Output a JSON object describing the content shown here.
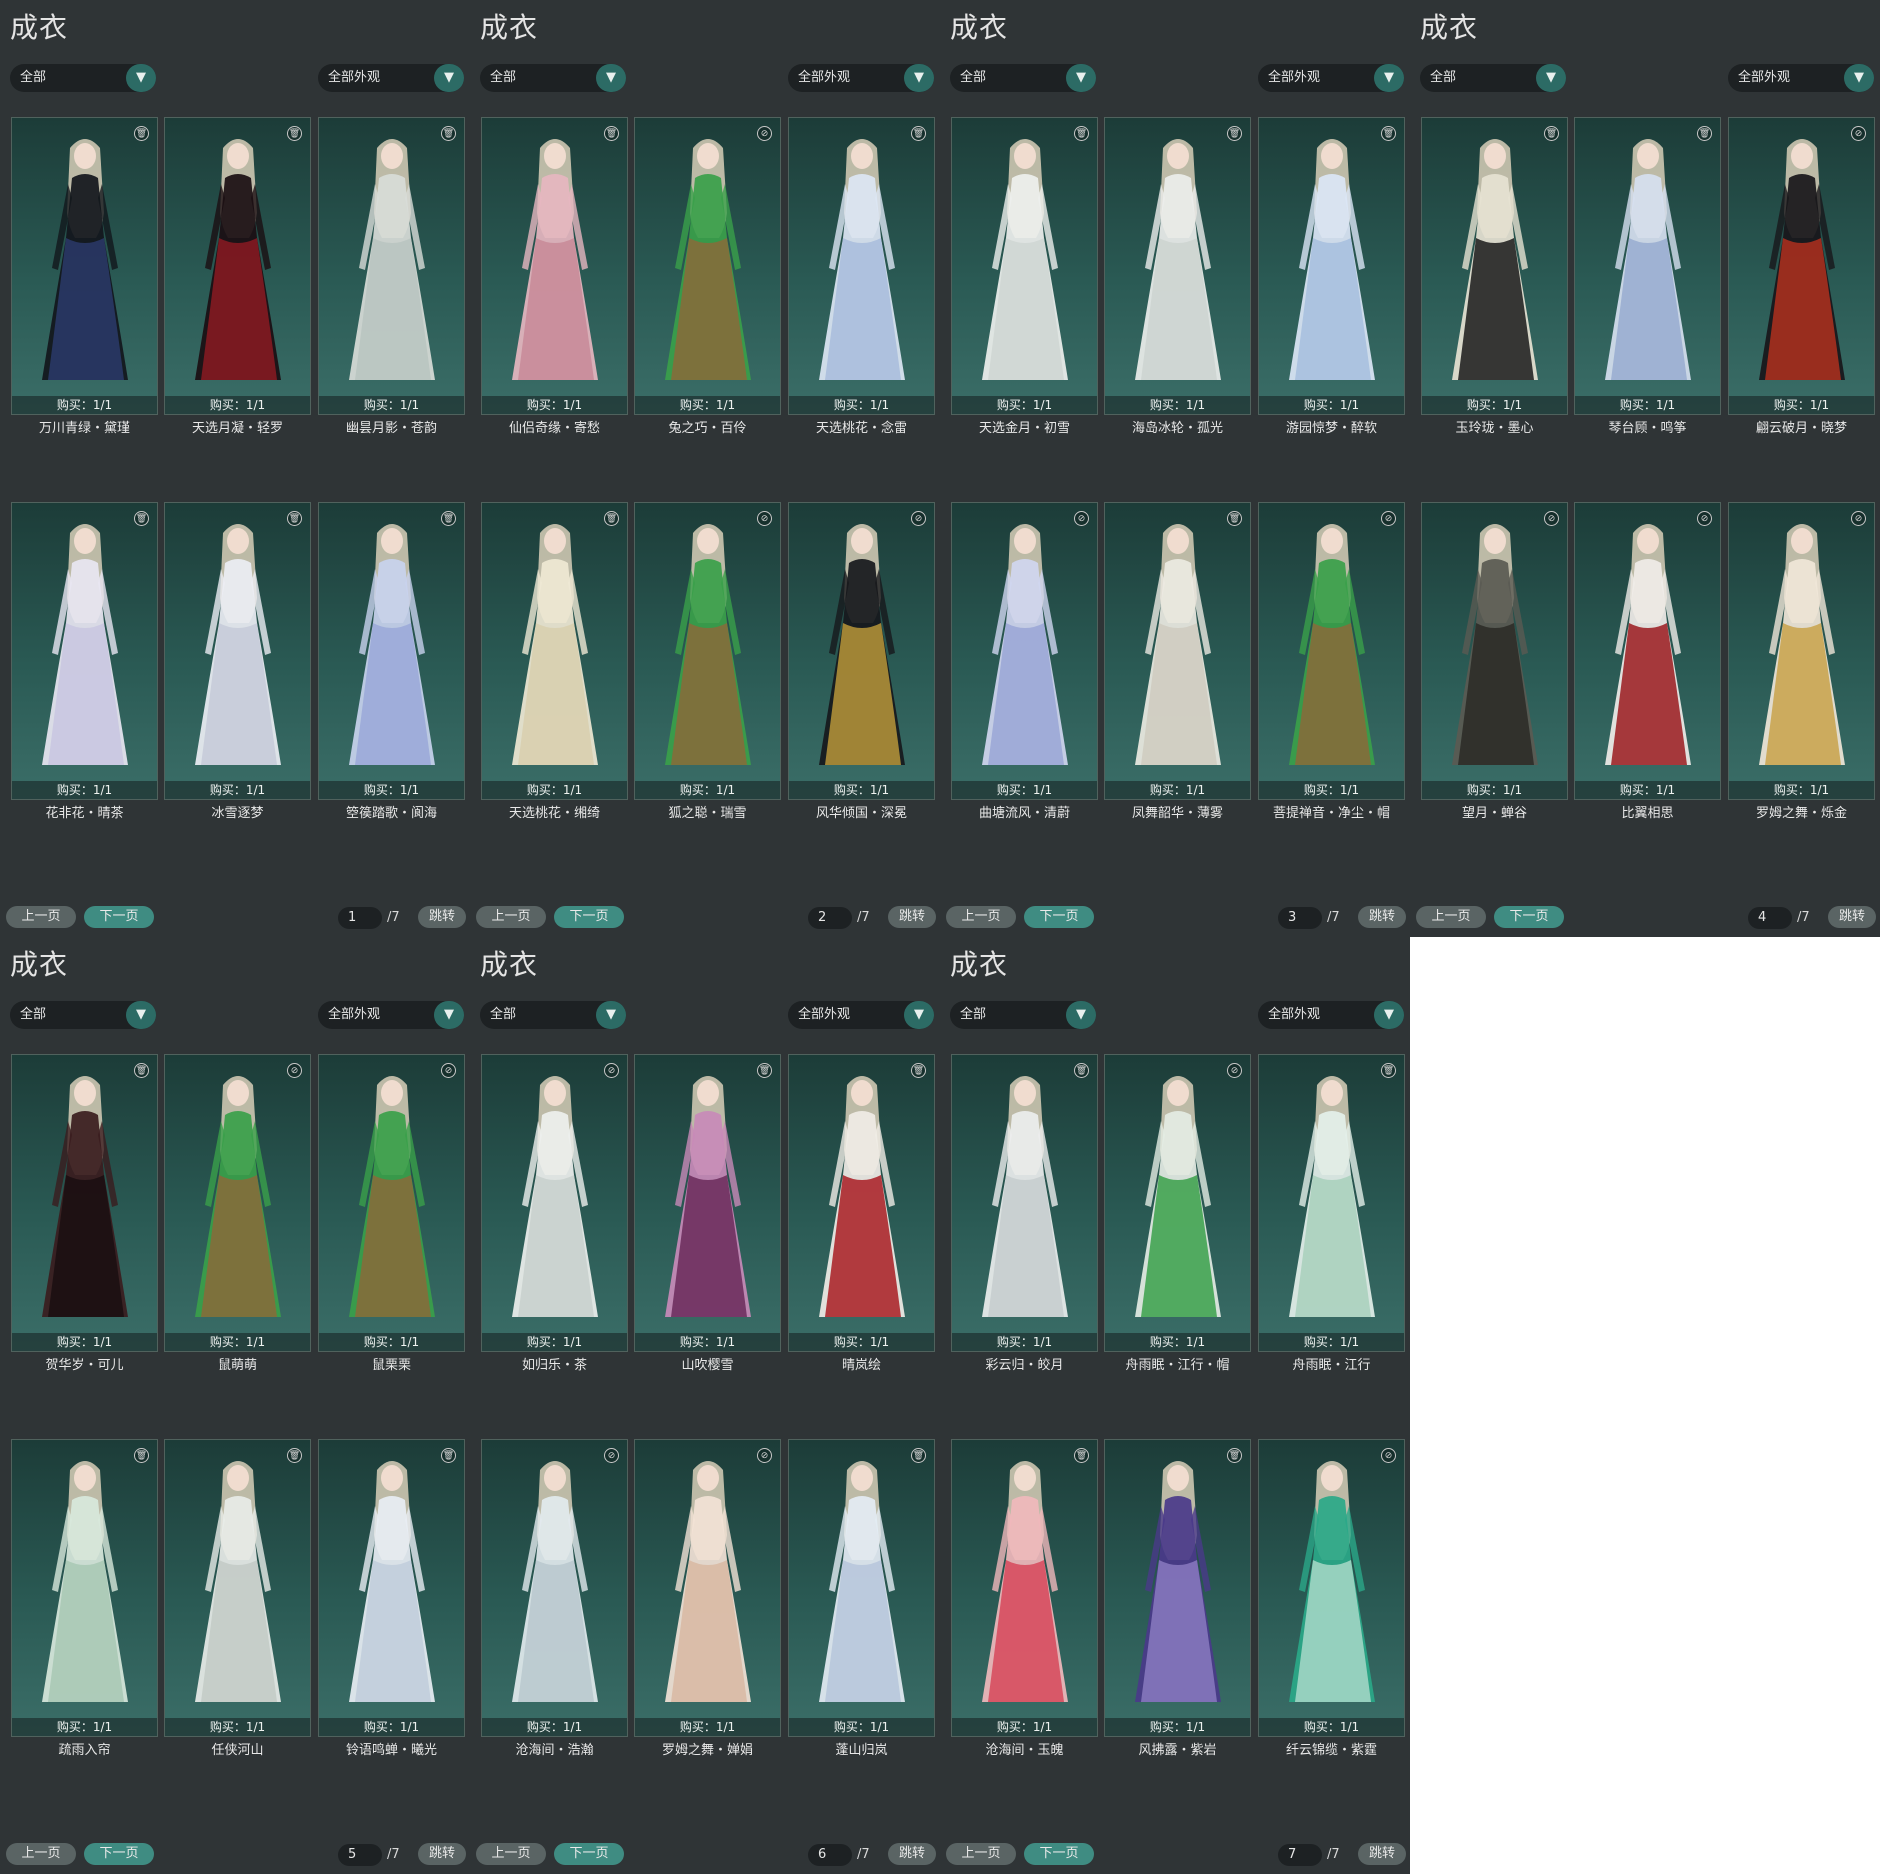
{
  "common": {
    "title": "成衣",
    "category": "全部",
    "appearance": "全部外观",
    "prev": "上一页",
    "next": "下一页",
    "jump": "跳转",
    "total": "/7",
    "purchase": "购买：1/1"
  },
  "panels": [
    {
      "page": "1",
      "items": [
        {
          "name": "万川青绿・黛瑾",
          "palette": [
            "#12161c",
            "#2a3a6a"
          ],
          "icon": "trash-icon"
        },
        {
          "name": "天选月凝・轻罗",
          "palette": [
            "#1a0e12",
            "#8a1a22"
          ],
          "icon": "trash-icon"
        },
        {
          "name": "幽昙月影・苍韵",
          "palette": [
            "#d8dcd8",
            "#b8c4c0"
          ],
          "icon": "trash-icon"
        },
        {
          "name": "花非花・晴茶",
          "palette": [
            "#e8e6f2",
            "#c8c6e0"
          ],
          "icon": "trash-icon"
        },
        {
          "name": "冰雪逐梦",
          "palette": [
            "#eceef4",
            "#c6cad8"
          ],
          "icon": "trash-icon"
        },
        {
          "name": "箜篌踏歌・阆海",
          "palette": [
            "#c8d2ee",
            "#9aa8d8"
          ],
          "icon": "trash-icon"
        }
      ]
    },
    {
      "page": "2",
      "items": [
        {
          "name": "仙侣奇缘・寄愁",
          "palette": [
            "#e6b6c0",
            "#c88a98"
          ],
          "icon": "trash-icon"
        },
        {
          "name": "兔之巧・百伶",
          "palette": [
            "#3aa04a",
            "#8a6a3a"
          ],
          "icon": "wardrobe-icon"
        },
        {
          "name": "天选桃花・念雷",
          "palette": [
            "#dce6f4",
            "#a8bcdc"
          ],
          "icon": "trash-icon"
        },
        {
          "name": "天选桃花・缃绮",
          "palette": [
            "#efe8d4",
            "#d8cfae"
          ],
          "icon": "trash-icon"
        },
        {
          "name": "狐之聪・瑞雪",
          "palette": [
            "#3aa04a",
            "#8a6a3a"
          ],
          "icon": "wardrobe-icon"
        },
        {
          "name": "风华倾国・深冕",
          "palette": [
            "#16181c",
            "#b8963a"
          ],
          "icon": "wardrobe-icon"
        }
      ]
    },
    {
      "page": "3",
      "items": [
        {
          "name": "天选金月・初雪",
          "palette": [
            "#eef0ee",
            "#cfd6d2"
          ],
          "icon": "trash-icon"
        },
        {
          "name": "海岛冰轮・孤光",
          "palette": [
            "#eceeec",
            "#cdd3d0"
          ],
          "icon": "trash-icon"
        },
        {
          "name": "游园惊梦・醉软",
          "palette": [
            "#dbe6f6",
            "#a6bede"
          ],
          "icon": "trash-icon"
        },
        {
          "name": "曲塘流风・清蔚",
          "palette": [
            "#d0d6f0",
            "#9aa6d6"
          ],
          "icon": "wardrobe-icon"
        },
        {
          "name": "凤舞韶华・薄雾",
          "palette": [
            "#eceae2",
            "#cfcbc0"
          ],
          "icon": "trash-icon"
        },
        {
          "name": "菩提禅音・净尘・帽",
          "palette": [
            "#3aa04a",
            "#8a6a3a"
          ],
          "icon": "wardrobe-icon"
        }
      ]
    },
    {
      "page": "4",
      "items": [
        {
          "name": "玉玲珑・墨心",
          "palette": [
            "#e6e2d2",
            "#1a1a1a"
          ],
          "icon": "trash-icon"
        },
        {
          "name": "琴台顾・鸣筝",
          "palette": [
            "#d6e0f0",
            "#98acd0"
          ],
          "icon": "trash-icon"
        },
        {
          "name": "翩云破月・晓梦",
          "palette": [
            "#18161a",
            "#b0301e"
          ],
          "icon": "wardrobe-icon"
        },
        {
          "name": "望月・蝉谷",
          "palette": [
            "#5a5a52",
            "#2a2a26"
          ],
          "icon": "wardrobe-icon"
        },
        {
          "name": "比翼相思",
          "palette": [
            "#f0ece8",
            "#9a1a1e"
          ],
          "icon": "wardrobe-icon"
        },
        {
          "name": "罗姆之舞・烁金",
          "palette": [
            "#f0e6d8",
            "#c8a24a"
          ],
          "icon": "wardrobe-icon"
        }
      ]
    },
    {
      "page": "5",
      "items": [
        {
          "name": "贺华岁・可儿",
          "palette": [
            "#3a1c1e",
            "#1a0e10"
          ],
          "icon": "trash-icon"
        },
        {
          "name": "鼠萌萌",
          "palette": [
            "#3aa04a",
            "#8a6a3a"
          ],
          "icon": "wardrobe-icon"
        },
        {
          "name": "鼠栗栗",
          "palette": [
            "#3aa04a",
            "#8a6a3a"
          ],
          "icon": "wardrobe-icon"
        },
        {
          "name": "疏雨入帘",
          "palette": [
            "#d8e8dc",
            "#a8c8b4"
          ],
          "icon": "trash-icon"
        },
        {
          "name": "任侠河山",
          "palette": [
            "#e8ece8",
            "#c2cac6"
          ],
          "icon": "trash-icon"
        },
        {
          "name": "铃语鸣蝉・曦光",
          "palette": [
            "#e8eef4",
            "#c0ccda"
          ],
          "icon": "trash-icon"
        }
      ]
    },
    {
      "page": "6",
      "items": [
        {
          "name": "如归乐・茶",
          "palette": [
            "#eef0ee",
            "#c8d0cc"
          ],
          "icon": "wardrobe-icon"
        },
        {
          "name": "山吹樱雪",
          "palette": [
            "#c88ab8",
            "#6a2a5a"
          ],
          "icon": "trash-icon"
        },
        {
          "name": "晴岚绘",
          "palette": [
            "#f0ece6",
            "#a81c22"
          ],
          "icon": "trash-icon"
        },
        {
          "name": "沧海间・浩瀚",
          "palette": [
            "#e2eaee",
            "#b8c8ce"
          ],
          "icon": "wardrobe-icon"
        },
        {
          "name": "罗姆之舞・婵娟",
          "palette": [
            "#f2e2d6",
            "#d8b8a2"
          ],
          "icon": "wardrobe-icon"
        },
        {
          "name": "蓬山归岚",
          "palette": [
            "#e4ecf4",
            "#b6c6da"
          ],
          "icon": "trash-icon"
        }
      ]
    },
    {
      "page": "7",
      "items": [
        {
          "name": "彩云归・皎月",
          "palette": [
            "#eceeee",
            "#c6ccce"
          ],
          "icon": "trash-icon"
        },
        {
          "name": "舟雨眠・江行・帽",
          "palette": [
            "#e4ece4",
            "#3aa04a"
          ],
          "icon": "wardrobe-icon"
        },
        {
          "name": "舟雨眠・江行",
          "palette": [
            "#e4f0ea",
            "#a8d0bc"
          ],
          "icon": "trash-icon"
        },
        {
          "name": "沧海间・玉魄",
          "palette": [
            "#f0b8bc",
            "#d6485a"
          ],
          "icon": "trash-icon"
        },
        {
          "name": "风拂露・紫岩",
          "palette": [
            "#4a3a8a",
            "#8a7ac0"
          ],
          "icon": "trash-icon"
        },
        {
          "name": "纤云锦缆・紫霆",
          "palette": [
            "#2aa888",
            "#a8d8c8"
          ],
          "icon": "wardrobe-icon"
        }
      ]
    }
  ]
}
